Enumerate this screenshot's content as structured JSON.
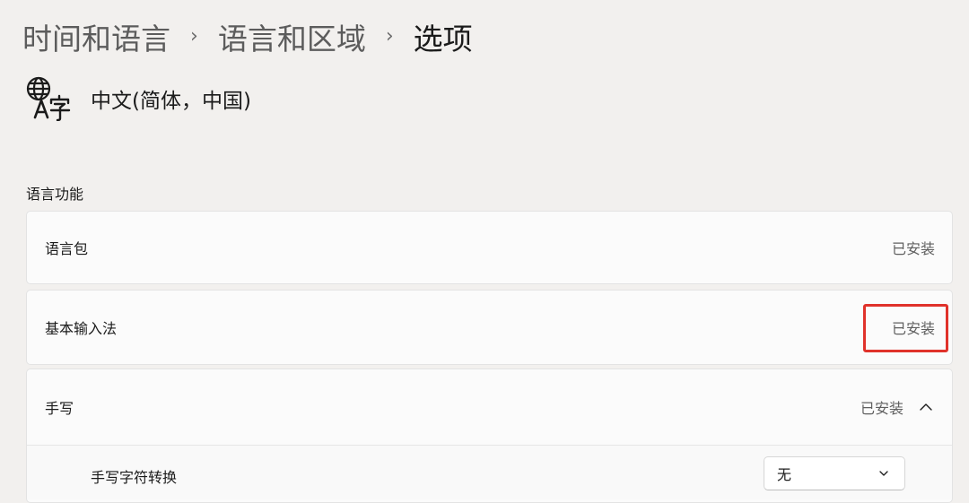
{
  "breadcrumb": {
    "items": [
      "时间和语言",
      "语言和区域",
      "选项"
    ],
    "separator": "›"
  },
  "language": {
    "icon": "language-translate-icon",
    "name": "中文(简体，中国)"
  },
  "section": {
    "title": "语言功能"
  },
  "features": [
    {
      "label": "语言包",
      "status": "已安装"
    },
    {
      "label": "基本输入法",
      "status": "已安装",
      "highlighted": true
    },
    {
      "label": "手写",
      "status": "已安装",
      "expanded": true
    }
  ],
  "handwriting_options": {
    "label": "手写字符转换",
    "dropdown_value": "无"
  },
  "colors": {
    "background": "#f2f0ee",
    "card": "#fbfbfb",
    "highlight": "#e0322b",
    "secondary_text": "#5f5f5f"
  }
}
